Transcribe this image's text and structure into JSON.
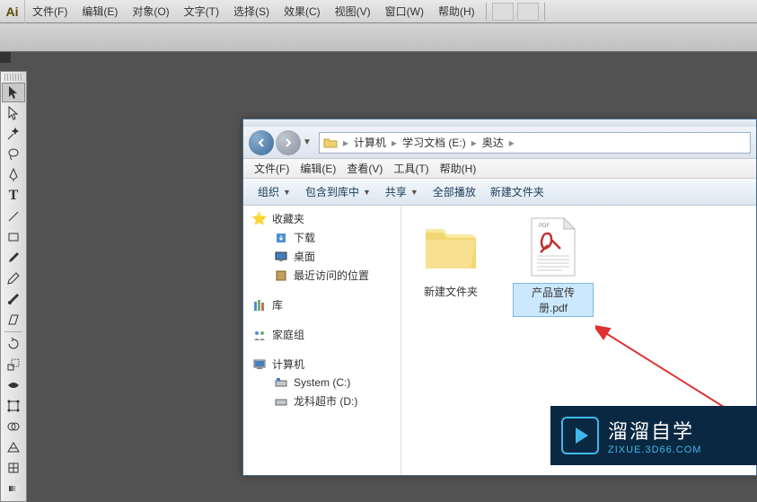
{
  "ai": {
    "logo": "Ai",
    "menu": [
      "文件(F)",
      "编辑(E)",
      "对象(O)",
      "文字(T)",
      "选择(S)",
      "效果(C)",
      "视图(V)",
      "窗口(W)",
      "帮助(H)"
    ]
  },
  "explorer": {
    "breadcrumb": {
      "root_icon": "computer",
      "segments": [
        "计算机",
        "学习文档 (E:)",
        "奥达"
      ]
    },
    "menubar": [
      "文件(F)",
      "编辑(E)",
      "查看(V)",
      "工具(T)",
      "帮助(H)"
    ],
    "toolbar": {
      "organize": "组织",
      "include": "包含到库中",
      "share": "共享",
      "playall": "全部播放",
      "newfolder": "新建文件夹"
    },
    "sidebar": {
      "favorites": {
        "label": "收藏夹",
        "items": [
          "下载",
          "桌面",
          "最近访问的位置"
        ]
      },
      "libraries": {
        "label": "库"
      },
      "homegroup": {
        "label": "家庭组"
      },
      "computer": {
        "label": "计算机",
        "items": [
          "System (C:)",
          "龙科超市 (D:)"
        ]
      }
    },
    "files": [
      {
        "name": "新建文件夹",
        "type": "folder"
      },
      {
        "name": "产品宣传册.pdf",
        "type": "pdf"
      }
    ]
  },
  "watermark": {
    "title": "溜溜自学",
    "url": "ZIXUE.3D66.COM"
  }
}
